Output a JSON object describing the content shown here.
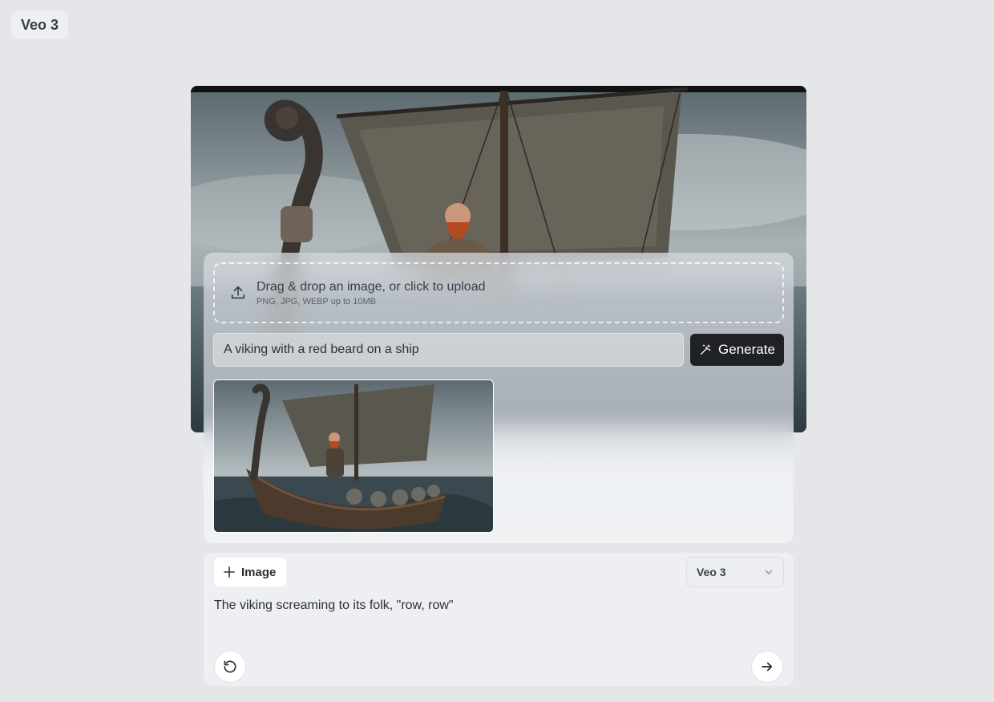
{
  "app": {
    "title": "Veo 3"
  },
  "upload": {
    "title": "Drag & drop an image, or click to upload",
    "subtitle": "PNG, JPG, WEBP up to 10MB"
  },
  "generate_form": {
    "prompt_value": "A viking with a red beard on a ship",
    "generate_label": "Generate"
  },
  "composer": {
    "image_button_label": "Image",
    "model_selected": "Veo 3",
    "prompt_text": "The viking screaming to its folk, \"row, row\""
  },
  "colors": {
    "background": "#e5e6ea",
    "primary_button": "#1f2125"
  },
  "icons": [
    "upload-icon",
    "magic-wand-icon",
    "plus-icon",
    "chevron-down-icon",
    "reset-icon",
    "arrow-right-icon"
  ]
}
